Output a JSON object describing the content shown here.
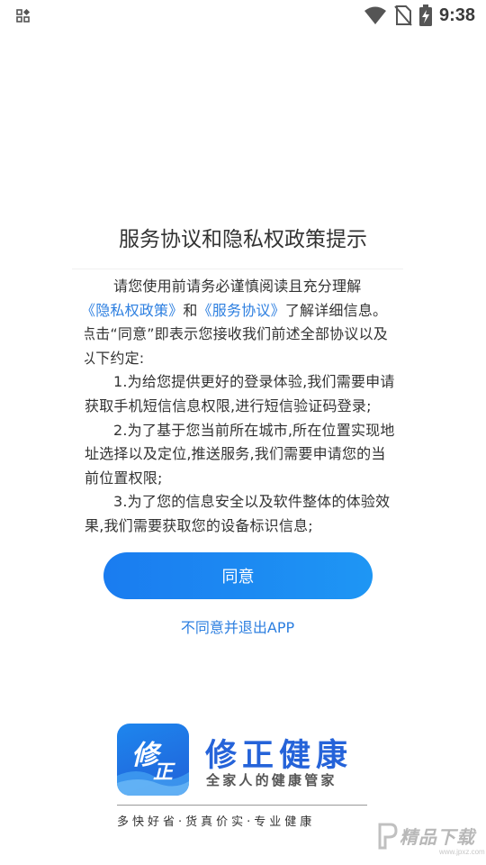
{
  "status_bar": {
    "time": "9:38",
    "icons": [
      "apps-grid-icon",
      "wifi-icon",
      "no-sim-icon",
      "battery-charging-icon"
    ]
  },
  "dialog": {
    "title": "服务协议和隐私权政策提示",
    "intro": "请您使用前请务必谨慎阅读且充分理解",
    "privacy_link": "《隐私权政策》",
    "and_text": "和",
    "service_link": "《服务协议》",
    "intro_tail": "了解详细信息。点击“同意”即表示您接收我们前述全部协议以及以下约定:",
    "item_1": "1.为给您提供更好的登录体验,我们需要申请获取手机短信信息权限,进行短信验证码登录;",
    "item_2": "2.为了基于您当前所在城市,所在位置实现地址选择以及定位,推送服务,我们需要申请您的当前位置权限;",
    "item_3": "3.为了您的信息安全以及软件整体的体验效果,我们需要获取您的设备标识信息;"
  },
  "buttons": {
    "agree_label": "同意",
    "disagree_label": "不同意并退出APP"
  },
  "brand": {
    "name": "修正健康",
    "slogan": "全家人的健康管家",
    "tagline": "多快好省·货真价实·专业健康",
    "logo_text_top": "修",
    "logo_text_bottom": "正"
  },
  "watermark": {
    "text": "精品下载",
    "sub": "www.jpxz.com"
  },
  "colors": {
    "accent": "#1a7cf0",
    "link": "#2d7fe0",
    "brand": "#2563d9"
  }
}
